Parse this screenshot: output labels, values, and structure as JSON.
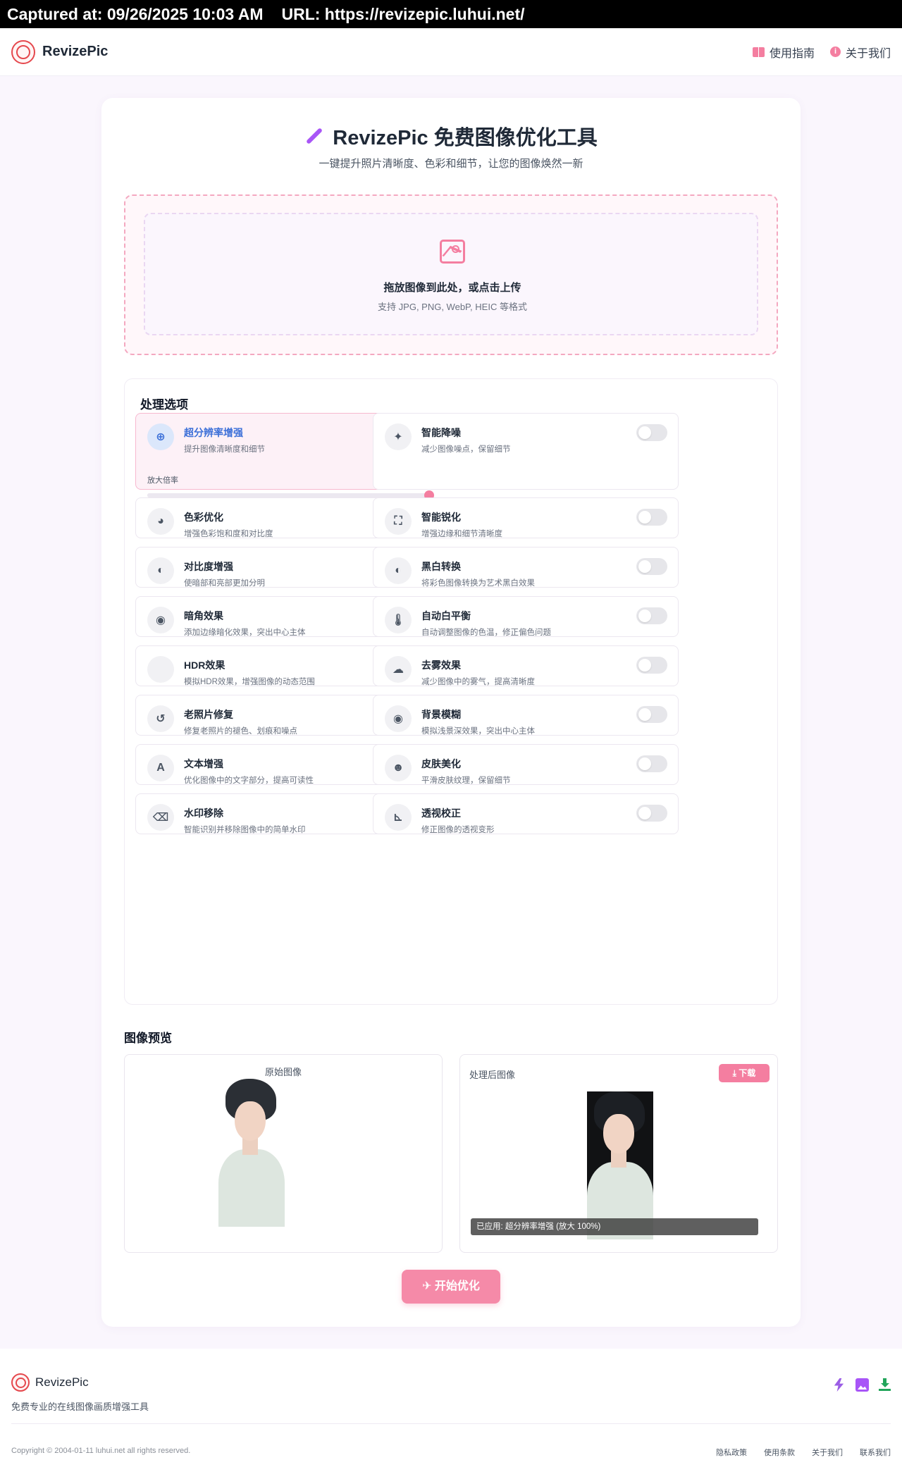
{
  "capture": {
    "captured_at": "Captured at: 09/26/2025 10:03 AM",
    "url": "URL: https://revizepic.luhui.net/"
  },
  "nav": {
    "brand": "RevizePic",
    "links": [
      {
        "label": "使用指南",
        "icon": "book-icon"
      },
      {
        "label": "关于我们",
        "icon": "info-icon"
      }
    ]
  },
  "hero": {
    "title": "RevizePic 免费图像优化工具",
    "subtitle": "一键提升照片清晰度、色彩和细节，让您的图像焕然一新"
  },
  "upload": {
    "title": "拖放图像到此处，或点击上传",
    "hint": "支持 JPG, PNG, WebP, HEIC 等格式"
  },
  "options": {
    "title": "处理选项",
    "scale_label": "放大倍率",
    "scale_value": "100%",
    "scale_percent": 100,
    "items": [
      {
        "name": "超分辨率增强",
        "desc": "提升图像清晰度和细节",
        "icon": "zoom-in-icon",
        "glyph": "⊕",
        "on": true
      },
      {
        "name": "智能降噪",
        "desc": "减少图像噪点，保留细节",
        "icon": "magic-wand-icon",
        "glyph": "✦",
        "on": false
      },
      {
        "name": "色彩优化",
        "desc": "增强色彩饱和度和对比度",
        "icon": "palette-icon",
        "glyph": "◕",
        "on": false
      },
      {
        "name": "智能锐化",
        "desc": "增强边缘和细节清晰度",
        "icon": "focus-frame-icon",
        "glyph": "⛶",
        "on": false
      },
      {
        "name": "对比度增强",
        "desc": "使暗部和亮部更加分明",
        "icon": "contrast-icon",
        "glyph": "◐",
        "on": false
      },
      {
        "name": "黑白转换",
        "desc": "将彩色图像转换为艺术黑白效果",
        "icon": "contrast-icon",
        "glyph": "◐",
        "on": false
      },
      {
        "name": "暗角效果",
        "desc": "添加边缘暗化效果，突出中心主体",
        "icon": "circle-dot-icon",
        "glyph": "◉",
        "on": false
      },
      {
        "name": "自动白平衡",
        "desc": "自动调整图像的色温，修正偏色问题",
        "icon": "thermometer-icon",
        "glyph": "🌡",
        "on": false
      },
      {
        "name": "HDR效果",
        "desc": "模拟HDR效果，增强图像的动态范围",
        "icon": "hdr-icon",
        "glyph": "",
        "on": false
      },
      {
        "name": "去雾效果",
        "desc": "减少图像中的雾气，提高清晰度",
        "icon": "cloud-sun-icon",
        "glyph": "☁",
        "on": false
      },
      {
        "name": "老照片修复",
        "desc": "修复老照片的褪色、划痕和噪点",
        "icon": "history-icon",
        "glyph": "↺",
        "on": false
      },
      {
        "name": "背景模糊",
        "desc": "模拟浅景深效果，突出中心主体",
        "icon": "circle-dot-icon",
        "glyph": "◉",
        "on": false
      },
      {
        "name": "文本增强",
        "desc": "优化图像中的文字部分，提高可读性",
        "icon": "font-icon",
        "glyph": "A",
        "on": false
      },
      {
        "name": "皮肤美化",
        "desc": "平滑皮肤纹理，保留细节",
        "icon": "smile-icon",
        "glyph": "☻",
        "on": false
      },
      {
        "name": "水印移除",
        "desc": "智能识别并移除图像中的简单水印",
        "icon": "eraser-icon",
        "glyph": "⌫",
        "on": false
      },
      {
        "name": "透视校正",
        "desc": "修正图像的透视变形",
        "icon": "ruler-combined-icon",
        "glyph": "⊾",
        "on": false
      }
    ]
  },
  "preview": {
    "title": "图像预览",
    "original_label": "原始图像",
    "processed_label": "处理后图像",
    "download_label": "⤓ 下载",
    "applied_text": "已应用: 超分辨率增强 (放大 100%)"
  },
  "start_button": "✈ 开始优化",
  "footer": {
    "brand": "RevizePic",
    "tagline": "免费专业的在线图像画质增强工具",
    "copyright": "Copyright © 2004-01-11 luhui.net all rights reserved.",
    "links": [
      "隐私政策",
      "使用条款",
      "关于我们",
      "联系我们"
    ]
  },
  "colors": {
    "accent": "#f47ea0",
    "active_blue": "#3b6fd8",
    "page_bg": "#faf6fd"
  }
}
